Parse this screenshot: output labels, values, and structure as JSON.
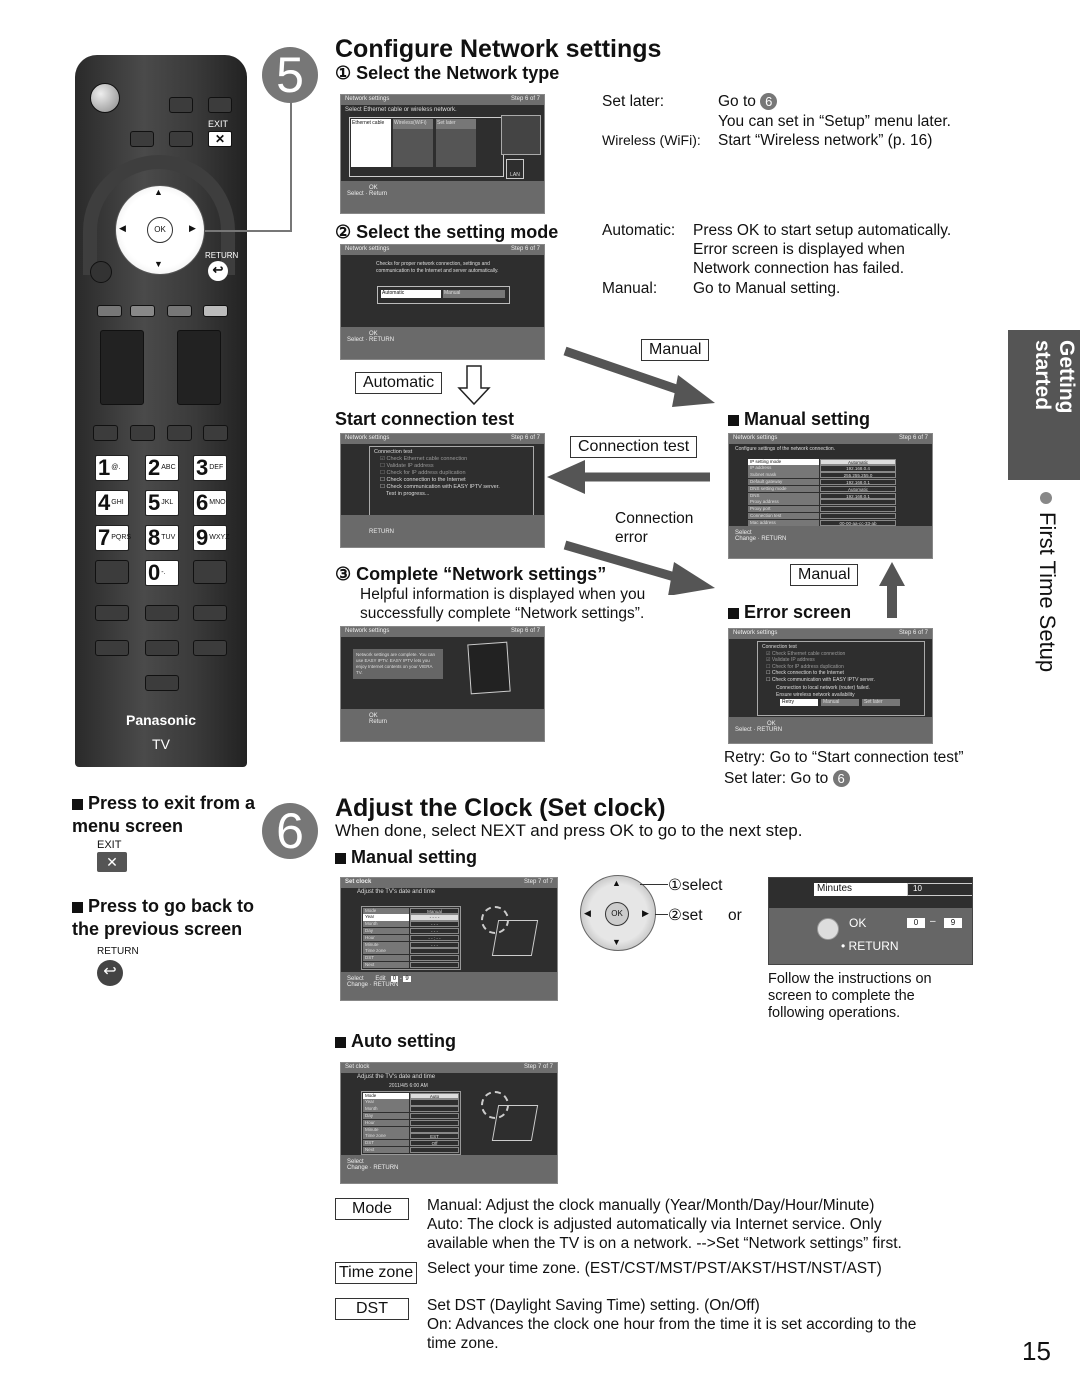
{
  "remote": {
    "exit_label": "EXIT",
    "return_label": "RETURN",
    "ok_label": "OK",
    "brand": "Panasonic",
    "tv_label": "TV",
    "number_keys": [
      {
        "digit": "1",
        "letters": "@."
      },
      {
        "digit": "2",
        "letters": "ABC"
      },
      {
        "digit": "3",
        "letters": "DEF"
      },
      {
        "digit": "4",
        "letters": "GHI"
      },
      {
        "digit": "5",
        "letters": "JKL"
      },
      {
        "digit": "6",
        "letters": "MNO"
      },
      {
        "digit": "7",
        "letters": "PQRS"
      },
      {
        "digit": "8",
        "letters": "TUV"
      },
      {
        "digit": "9",
        "letters": "WXYZ"
      },
      {
        "digit": "0",
        "letters": "-."
      }
    ]
  },
  "left_notes": {
    "exit_note": "Press to exit from a menu screen",
    "exit_label": "EXIT",
    "return_note": "Press to go back to the previous screen",
    "return_label": "RETURN"
  },
  "side_tab": {
    "section": "Getting started",
    "subsection": "First Time Setup"
  },
  "step5": {
    "number": "5",
    "title": "Configure Network settings",
    "sub1": {
      "marker": "①",
      "title": "Select the Network type",
      "screen": {
        "header": "Network settings",
        "step": "Step 6 of 7",
        "instruction": "Select Ethernet cable or wireless network.",
        "options": [
          "Ethernet cable",
          "Wireless(WiFi)",
          "Set later"
        ],
        "lan_label": "LAN",
        "footer_select": "Select",
        "footer_ok": "OK",
        "footer_return": "Return"
      },
      "notes": [
        {
          "label": "Set later:",
          "text": "Go to",
          "circle": "6",
          "extra": "You can set in “Setup” menu later."
        },
        {
          "label": "Wireless (WiFi):",
          "text": "Start “Wireless network” (p. 16)"
        }
      ]
    },
    "sub2": {
      "marker": "②",
      "title": "Select the setting mode",
      "screen": {
        "header": "Network settings",
        "step": "Step 6 of 7",
        "description": "Checks for proper network connection, settings and communication to the Internet and server automatically.",
        "options": [
          "Automatic",
          "Manual"
        ],
        "footer_select": "Select",
        "footer_ok": "OK",
        "footer_return": "RETURN"
      },
      "notes": [
        {
          "label": "Automatic:",
          "lines": [
            "Press OK to start setup automatically.",
            "Error screen is displayed when",
            "Network connection has failed."
          ]
        },
        {
          "label": "Manual:",
          "lines": [
            "Go to Manual setting."
          ]
        }
      ]
    },
    "flow_labels": {
      "automatic": "Automatic",
      "manual_top": "Manual",
      "connection_test": "Connection test",
      "connection_error": "Connection error",
      "manual_bottom": "Manual"
    },
    "connection_test": {
      "title": "Start connection test",
      "screen": {
        "header": "Network settings",
        "step": "Step 6 of 7",
        "box_title": "Connection test",
        "checks": [
          {
            "label": "Check Ethernet cable connection",
            "checked": true
          },
          {
            "label": "Validate IP address",
            "checked": false
          },
          {
            "label": "Check for IP address duplication",
            "checked": false
          },
          {
            "label": "Check connection to the Internet",
            "checked": false
          },
          {
            "label": "Check communication with EASY IPTV server.",
            "checked": false
          }
        ],
        "status": "Test in progress...",
        "footer_return": "RETURN"
      }
    },
    "manual_setting": {
      "title": "Manual setting",
      "screen": {
        "header": "Network settings",
        "step": "Step 6 of 7",
        "instruction": "Configure settings of the network connection.",
        "rows": [
          {
            "label": "IP setting mode",
            "value": "Automatic"
          },
          {
            "label": "IP address",
            "value": "192.168.0.4"
          },
          {
            "label": "Subnet mask",
            "value": "255.255.255.0"
          },
          {
            "label": "Default gateway",
            "value": "192.168.0.1"
          },
          {
            "label": "DNS setting mode",
            "value": "Automatic"
          },
          {
            "label": "DNS",
            "value": "192.168.0.1"
          },
          {
            "label": "Proxy address",
            "value": ""
          },
          {
            "label": "Proxy port",
            "value": ""
          },
          {
            "label": "Connection test",
            "value": ""
          },
          {
            "label": "Mac address",
            "value": "00-00-aa-cc-33-ab"
          }
        ],
        "footer_select": "Select",
        "footer_change": "Change",
        "footer_return": "RETURN"
      }
    },
    "sub3": {
      "marker": "③",
      "title": "Complete “Network settings”",
      "description": "Helpful information is displayed when you successfully complete “Network settings”.",
      "screen": {
        "header": "Network settings",
        "step": "Step 6 of 7",
        "message": "Network settings are complete. You can use EASY IPTV. EASY IPTV lets you enjoy Internet contents on your VIERA TV.",
        "footer_ok": "OK",
        "footer_return": "Return"
      }
    },
    "error_screen": {
      "title": "Error screen",
      "screen": {
        "header": "Network settings",
        "step": "Step 6 of 7",
        "box_title": "Connection test",
        "checks": [
          {
            "label": "Check Ethernet cable connection",
            "checked": true
          },
          {
            "label": "Validate IP address",
            "checked": true
          },
          {
            "label": "Check for IP address duplication",
            "checked": false
          },
          {
            "label": "Check connection to the Internet",
            "checked": false
          },
          {
            "label": "Check communication with EASY IPTV server.",
            "checked": false
          }
        ],
        "message1": "Connection to local network (router) failed.",
        "message2": "Ensure wireless network availability",
        "buttons": [
          "Retry",
          "Manual",
          "Set later"
        ],
        "footer_select": "Select",
        "footer_ok": "OK",
        "footer_return": "RETURN"
      },
      "notes": [
        "Retry: Go to “Start connection test”",
        "Set later: Go to"
      ],
      "notes_circle": "6"
    }
  },
  "step6": {
    "number": "6",
    "title": "Adjust the Clock (Set clock)",
    "subtitle": "When done, select NEXT and press OK to go to the next step.",
    "manual": {
      "title": "Manual setting",
      "screen": {
        "header": "Set clock",
        "step": "Step 7 of 7",
        "instruction": "Adjust the TV's date and time",
        "rows": [
          {
            "label": "Mode",
            "value": "Manual"
          },
          {
            "label": "Year",
            "value": "- - - -"
          },
          {
            "label": "Month",
            "value": "- - -"
          },
          {
            "label": "Day",
            "value": "- - -"
          },
          {
            "label": "Hour",
            "value": "- - : - -"
          },
          {
            "label": "Minute",
            "value": "- - -"
          },
          {
            "label": "Time zone",
            "value": ""
          },
          {
            "label": "DST",
            "value": ""
          },
          {
            "label": "Next",
            "value": ""
          }
        ],
        "footer_select": "Select",
        "footer_change": "Change",
        "footer_edit": "Edit",
        "footer_range_from": "0",
        "footer_range_to": "9",
        "footer_return": "RETURN"
      },
      "dpad": {
        "select_marker": "①",
        "select_label": "select",
        "set_marker": "②",
        "set_label": "set",
        "ok": "OK",
        "or": "or"
      },
      "popup": {
        "row_label": "Minutes",
        "row_value": "10",
        "ok": "OK",
        "range_from": "0",
        "range_to": "9",
        "return": "RETURN"
      },
      "follow_note": "Follow the instructions on screen to complete the following operations."
    },
    "auto": {
      "title": "Auto setting",
      "screen": {
        "header": "Set clock",
        "step": "Step 7 of 7",
        "instruction": "Adjust the TV's date and time",
        "datetime": "2011/4/5   6:00 AM",
        "rows": [
          {
            "label": "Mode",
            "value": "Auto"
          },
          {
            "label": "Year",
            "value": ""
          },
          {
            "label": "Month",
            "value": ""
          },
          {
            "label": "Day",
            "value": ""
          },
          {
            "label": "Hour",
            "value": ""
          },
          {
            "label": "Minute",
            "value": ""
          },
          {
            "label": "Time zone",
            "value": "EST"
          },
          {
            "label": "DST",
            "value": "Off"
          },
          {
            "label": "Next",
            "value": ""
          }
        ],
        "footer_select": "Select",
        "footer_change": "Change",
        "footer_return": "RETURN"
      }
    },
    "definitions": [
      {
        "term": "Mode",
        "lines": [
          "Manual: Adjust the clock manually (Year/Month/Day/Hour/Minute)",
          "Auto: The clock is adjusted automatically via Internet service. Only",
          "available when the TV is on a network. -->Set “Network settings” first."
        ]
      },
      {
        "term": "Time zone",
        "lines": [
          "Select your time zone. (EST/CST/MST/PST/AKST/HST/NST/AST)"
        ]
      },
      {
        "term": "DST",
        "lines": [
          "Set DST (Daylight Saving Time) setting. (On/Off)",
          "On: Advances the clock one hour from the time it is set according to the",
          "time zone."
        ]
      }
    ]
  },
  "page_number": "15"
}
